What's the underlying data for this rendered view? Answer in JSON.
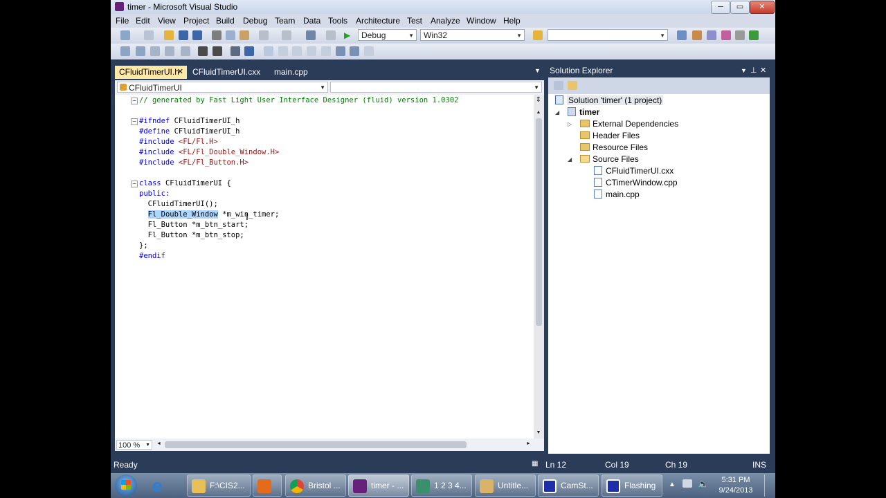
{
  "window": {
    "title": "timer - Microsoft Visual Studio",
    "min_label": "─",
    "max_label": "▭",
    "close_label": "✕"
  },
  "menu": [
    "File",
    "Edit",
    "View",
    "Project",
    "Build",
    "Debug",
    "Team",
    "Data",
    "Tools",
    "Architecture",
    "Test",
    "Analyze",
    "Window",
    "Help"
  ],
  "toolbar": {
    "config": "Debug",
    "platform": "Win32",
    "find_value": ""
  },
  "tabs": [
    {
      "label": "CFluidTimerUI.h",
      "active": true,
      "close": "✕"
    },
    {
      "label": "CFluidTimerUI.cxx",
      "active": false
    },
    {
      "label": "main.cpp",
      "active": false
    }
  ],
  "nav": {
    "scope": "CFluidTimerUI",
    "member": ""
  },
  "code": {
    "l1": "// generated by Fast Light User Interface Designer (fluid) version 1.0302",
    "l3a": "#ifndef ",
    "l3b": "CFluidTimerUI_h",
    "l4a": "#define ",
    "l4b": "CFluidTimerUI_h",
    "l5a": "#include ",
    "l5b": "<FL/Fl.H>",
    "l6a": "#include ",
    "l6b": "<FL/Fl_Double_Window.H>",
    "l7a": "#include ",
    "l7b": "<FL/Fl_Button.H>",
    "l9a": "class ",
    "l9b": "CFluidTimerUI {",
    "l10": "public:",
    "l11": "  CFluidTimerUI();",
    "l12a": "  ",
    "l12b": "Fl_Double_Window",
    "l12c": " *m_win_timer;",
    "l13": "  Fl_Button *m_btn_start;",
    "l14": "  Fl_Button *m_btn_stop;",
    "l15": "};",
    "l16": "#endif"
  },
  "zoom": "100 %",
  "solution_explorer": {
    "title": "Solution Explorer",
    "solution": "Solution 'timer' (1 project)",
    "project": "timer",
    "nodes": [
      "External Dependencies",
      "Header Files",
      "Resource Files",
      "Source Files"
    ],
    "files": [
      "CFluidTimerUI.cxx",
      "CTimerWindow.cpp",
      "main.cpp"
    ]
  },
  "status": {
    "ready": "Ready",
    "ln": "Ln 12",
    "col": "Col 19",
    "ch": "Ch 19",
    "mode": "INS"
  },
  "taskbar": {
    "items": [
      "F:\\CIS2...",
      "Bristol ...",
      "timer - ...",
      "1 2 3 4...",
      "Untitle...",
      "CamSt...",
      "Flashing"
    ],
    "time": "5:31 PM",
    "date": "9/24/2013"
  },
  "colors": {
    "vs_frame": "#2b3c59",
    "active_tab": "#ffe8a6",
    "selection": "#add6ff",
    "keyword": "#0000ff",
    "string": "#a31515",
    "comment": "#008000"
  }
}
